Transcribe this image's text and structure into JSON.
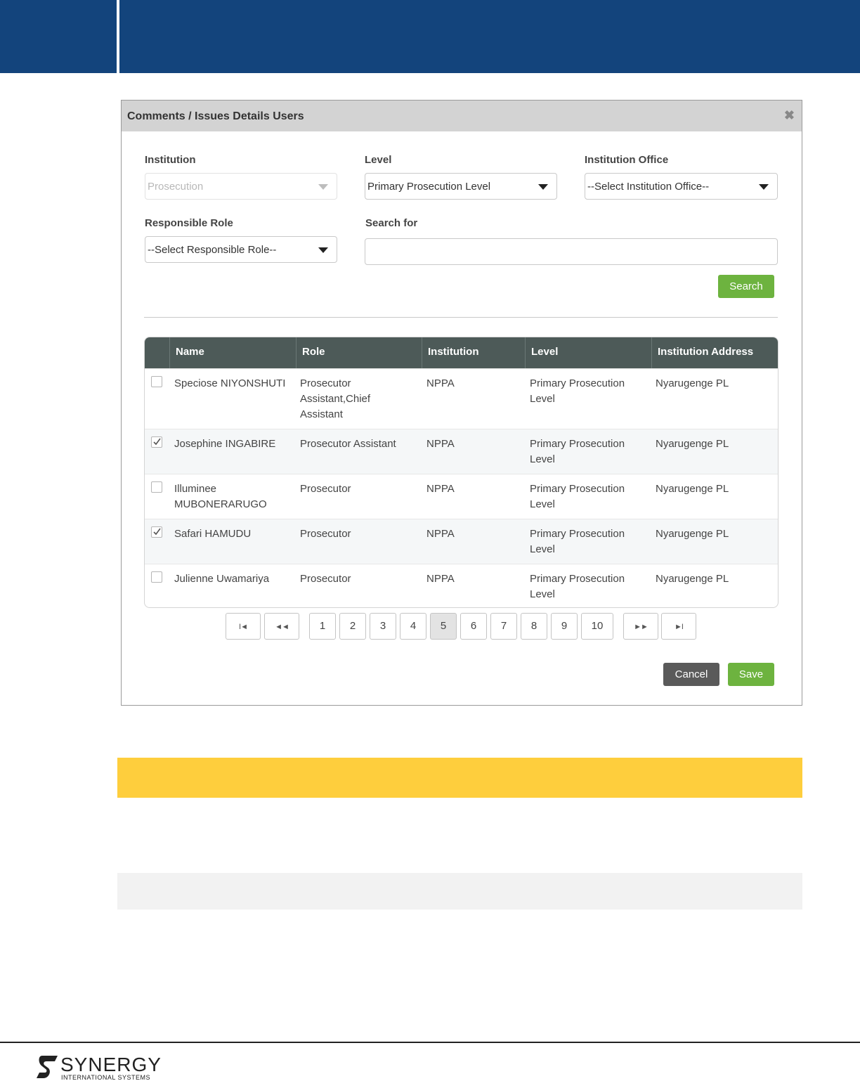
{
  "colors": {
    "band": "#13447c",
    "accent_green": "#6db33f",
    "header_row": "#4d5a58",
    "callout_yellow": "#fece3d"
  },
  "modal": {
    "title": "Comments / Issues Details Users",
    "close_icon": "close-icon",
    "filters": {
      "institution": {
        "label": "Institution",
        "value": "Prosecution",
        "disabled": true
      },
      "level": {
        "label": "Level",
        "value": "Primary Prosecution Level"
      },
      "institution_office": {
        "label": "Institution Office",
        "value": "--Select Institution Office--"
      },
      "responsible_role": {
        "label": "Responsible Role",
        "value": "--Select Responsible Role--"
      },
      "search_for": {
        "label": "Search for",
        "value": ""
      }
    },
    "search_button": "Search",
    "table": {
      "columns": [
        "Name",
        "Role",
        "Institution",
        "Level",
        "Institution Address"
      ],
      "rows": [
        {
          "checked": false,
          "name": "Speciose NIYONSHUTI",
          "role": "Prosecutor Assistant,Chief Assistant",
          "institution": "NPPA",
          "level": "Primary Prosecution Level",
          "address": "Nyarugenge PL"
        },
        {
          "checked": true,
          "name": "Josephine INGABIRE",
          "role": "Prosecutor Assistant",
          "institution": "NPPA",
          "level": "Primary Prosecution Level",
          "address": "Nyarugenge PL"
        },
        {
          "checked": false,
          "name": "Illuminee MUBONERARUGO",
          "role": "Prosecutor",
          "institution": "NPPA",
          "level": "Primary Prosecution Level",
          "address": "Nyarugenge PL"
        },
        {
          "checked": true,
          "name": "Safari HAMUDU",
          "role": "Prosecutor",
          "institution": "NPPA",
          "level": "Primary Prosecution Level",
          "address": "Nyarugenge PL"
        },
        {
          "checked": false,
          "name": "Julienne Uwamariya",
          "role": "Prosecutor",
          "institution": "NPPA",
          "level": "Primary Prosecution Level",
          "address": "Nyarugenge PL"
        }
      ]
    },
    "pagination": {
      "first": "I◄",
      "prev": "◄◄",
      "next": "►►",
      "last": "►I",
      "pages": [
        "1",
        "2",
        "3",
        "4",
        "5",
        "6",
        "7",
        "8",
        "9",
        "10"
      ],
      "current": "5"
    },
    "cancel_button": "Cancel",
    "save_button": "Save"
  },
  "footer": {
    "logo_word": "SYNERGY",
    "logo_sub": "INTERNATIONAL SYSTEMS"
  }
}
